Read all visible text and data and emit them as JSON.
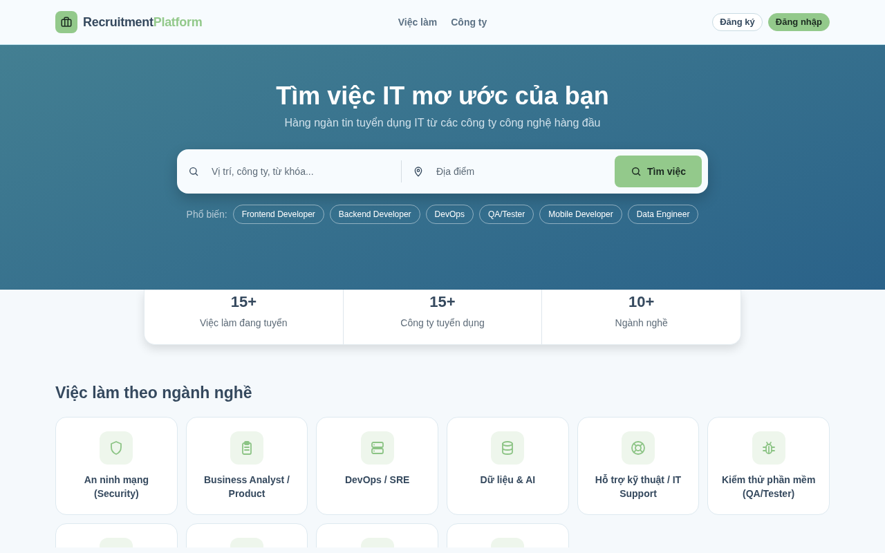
{
  "brand": {
    "part_1": "Recruitment",
    "part_2": "Platform"
  },
  "nav": [
    {
      "label": "Việc làm"
    },
    {
      "label": "Công ty"
    }
  ],
  "auth": [
    {
      "label": "Đăng ký",
      "kind": "outline"
    },
    {
      "label": "Đăng nhập",
      "kind": "solid"
    }
  ],
  "hero": {
    "title": "Tìm việc IT mơ ước của bạn",
    "subtitle": "Hàng ngàn tin tuyển dụng IT từ các công ty công nghệ hàng đầu",
    "search": {
      "placeholder": "Vị trí, công ty, từ khóa...",
      "location_placeholder": "Địa điểm",
      "button": "Tìm việc"
    },
    "popular_label": "Phổ biến:",
    "popular": [
      "Frontend Developer",
      "Backend Developer",
      "DevOps",
      "QA/Tester",
      "Mobile Developer",
      "Data Engineer"
    ]
  },
  "stats": [
    {
      "value": "15+",
      "label": "Việc làm đang tuyển"
    },
    {
      "value": "15+",
      "label": "Công ty tuyển dụng"
    },
    {
      "value": "10+",
      "label": "Ngành nghề"
    }
  ],
  "categories_title": "Việc làm theo ngành nghề",
  "categories": [
    {
      "kind": "category",
      "label": "An ninh mạng (Security)"
    },
    {
      "kind": "category",
      "label": "Business Analyst / Product"
    },
    {
      "kind": "category",
      "label": "DevOps / SRE"
    },
    {
      "kind": "category",
      "label": "Dữ liệu & AI"
    },
    {
      "kind": "category",
      "label": "Hỗ trợ kỹ thuật / IT Support"
    },
    {
      "kind": "category",
      "label": "Kiểm thử phần mềm (QA/Tester)"
    },
    {
      "kind": "category"
    },
    {
      "kind": "category"
    },
    {
      "kind": "category"
    },
    {
      "kind": "category"
    }
  ]
}
